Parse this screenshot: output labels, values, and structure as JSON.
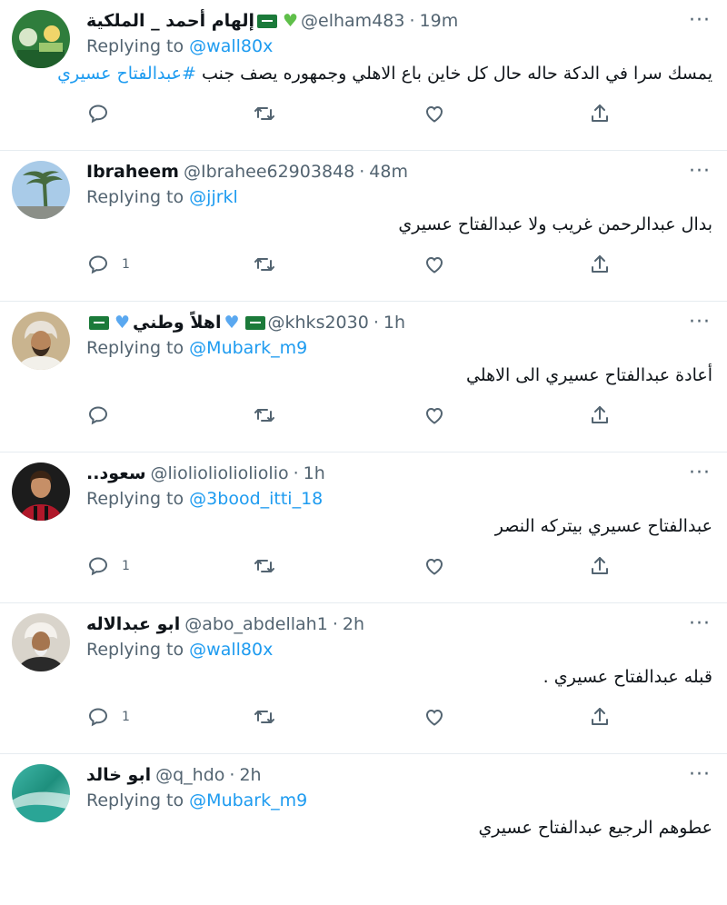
{
  "replying_label": "Replying to",
  "tweets": [
    {
      "name": "إلهام أحمد _ الملكية",
      "handle": "@elham483",
      "sep": "·",
      "time": "19m",
      "reply_to": "@wall80x",
      "text_before": "يمسك سرا في الدكة حاله حال كل خاين باع الاهلي وجمهوره يصف جنب ",
      "hashtag": "#عبدالفتاح عسيري",
      "text_after": "",
      "reply_count": "",
      "emojis": [
        "flag-icon",
        "green-heart-icon"
      ]
    },
    {
      "name": "Ibraheem",
      "handle": "@Ibrahee62903848",
      "sep": "·",
      "time": "48m",
      "reply_to": "@jjrkl",
      "text_before": "بدال عبدالرحمن غريب ولا عبدالفتاح عسيري",
      "hashtag": "",
      "text_after": "",
      "reply_count": "1",
      "emojis": []
    },
    {
      "name": "اهلاً وطني",
      "handle": "@khks2030",
      "sep": "·",
      "time": "1h",
      "reply_to": "@Mubark_m9",
      "text_before": "أعادة عبدالفتاح عسيري الى الاهلي",
      "hashtag": "",
      "text_after": "",
      "reply_count": "",
      "emojis": [
        "flag-icon",
        "blue-heart-icon",
        "flag-icon"
      ]
    },
    {
      "name": "..سعود",
      "handle": "@liolioliolioliolio",
      "sep": "·",
      "time": "1h",
      "reply_to": "@3bood_itti_18",
      "text_before": "عبدالفتاح عسيري بيتركه النصر",
      "hashtag": "",
      "text_after": "",
      "reply_count": "1",
      "emojis": []
    },
    {
      "name": "ابو عبدالاله",
      "handle": "@abo_abdellah1",
      "sep": "·",
      "time": "2h",
      "reply_to": "@wall80x",
      "text_before": "قبله عبدالفتاح عسيري .",
      "hashtag": "",
      "text_after": "",
      "reply_count": "1",
      "emojis": []
    },
    {
      "name": "ابو خالد",
      "handle": "@q_hdo",
      "sep": "·",
      "time": "2h",
      "reply_to": "@Mubark_m9",
      "text_before": "عطوهم الرجيع عبدالفتاح عسيري",
      "hashtag": "",
      "text_after": "",
      "reply_count": "",
      "emojis": []
    }
  ],
  "icons": {
    "reply": "reply-icon",
    "retweet": "retweet-icon",
    "like": "like-icon",
    "share": "share-icon",
    "more": "more-icon"
  },
  "colors": {
    "link": "#1d9bf0",
    "muted": "#536471",
    "text": "#0f1419",
    "divider": "#e6ecf0"
  }
}
